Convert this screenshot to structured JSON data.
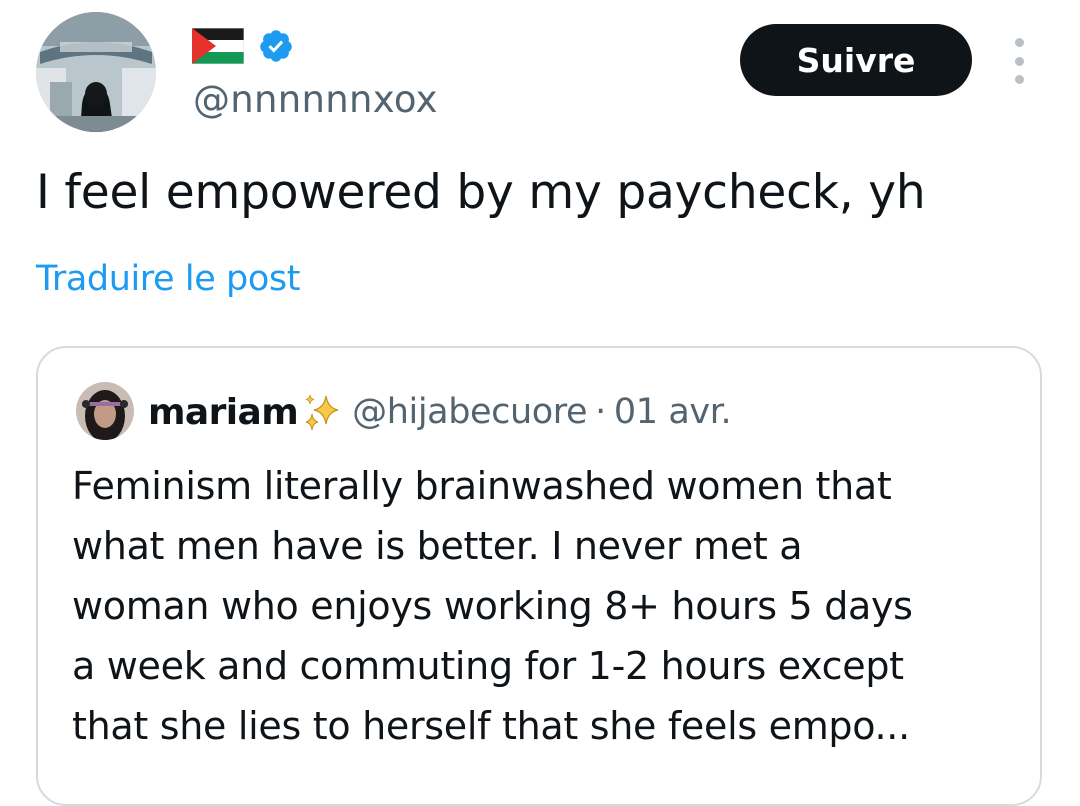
{
  "author": {
    "handle": "@nnnnnnxox",
    "flag_icon": "palestine-flag-icon",
    "verified_icon": "verified-badge-icon",
    "accent_color": "#1d9bf0"
  },
  "actions": {
    "follow_label": "Suivre",
    "more_icon": "more-vertical-icon"
  },
  "post": {
    "text": "I feel empowered by my paycheck, yh",
    "translate_label": "Traduire le post"
  },
  "quoted_post": {
    "name": "mariam",
    "name_emoji_icon": "sparkles-icon",
    "handle": "@hijabecuore",
    "separator": "·",
    "date": "01 avr.",
    "text_lines": [
      "Feminism literally brainwashed women that",
      "what men have is better. I never met a",
      "woman who enjoys working 8+ hours 5 days",
      "a week and commuting for 1-2 hours except",
      "that she lies to herself that she feels empo..."
    ]
  }
}
